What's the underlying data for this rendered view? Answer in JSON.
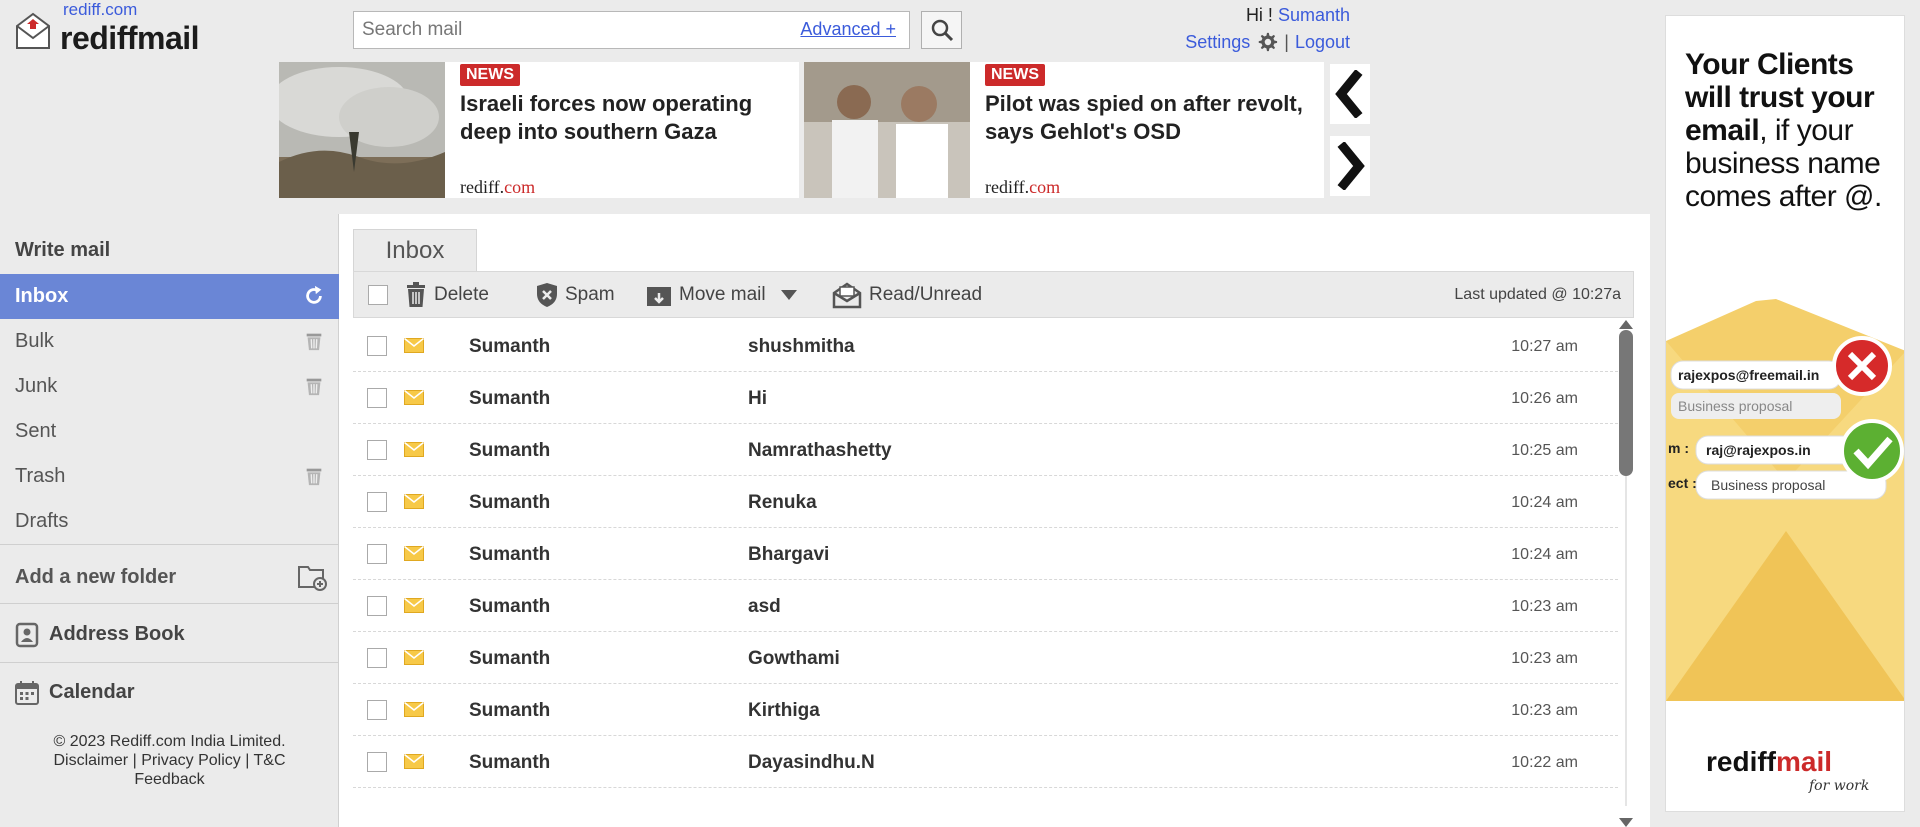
{
  "header": {
    "brand_link": "rediff.com",
    "brand_name": "rediffmail",
    "search_placeholder": "Search mail",
    "advanced_link": "Advanced +",
    "greeting_prefix": "Hi !",
    "user_name": "Sumanth",
    "settings_label": "Settings",
    "logout_label": "Logout"
  },
  "news": [
    {
      "badge": "NEWS",
      "headline": "Israeli forces now operating deep into southern Gaza",
      "source_a": "rediff.",
      "source_b": "com"
    },
    {
      "badge": "NEWS",
      "headline": "Pilot was spied on after revolt, says Gehlot's OSD",
      "source_a": "rediff.",
      "source_b": "com"
    }
  ],
  "sidebar": {
    "write_mail": "Write mail",
    "folders": [
      {
        "label": "Inbox",
        "active": true
      },
      {
        "label": "Bulk"
      },
      {
        "label": "Junk"
      },
      {
        "label": "Sent"
      },
      {
        "label": "Trash"
      },
      {
        "label": "Drafts"
      }
    ],
    "add_folder": "Add a new folder",
    "address_book": "Address Book",
    "calendar": "Calendar",
    "footer": {
      "copyright": "© 2023 Rediff.com India Limited.",
      "disclaimer": "Disclaimer",
      "privacy": "Privacy Policy",
      "tc": "T&C",
      "feedback": "Feedback",
      "separator": "|"
    }
  },
  "mail": {
    "tab_label": "Inbox",
    "toolbar": {
      "delete": "Delete",
      "spam": "Spam",
      "move": "Move mail",
      "read_unread": "Read/Unread",
      "last_updated": "Last updated  @ 10:27a"
    },
    "rows": [
      {
        "from": "Sumanth",
        "subject": "shushmitha",
        "time": "10:27 am"
      },
      {
        "from": "Sumanth",
        "subject": "Hi",
        "time": "10:26 am"
      },
      {
        "from": "Sumanth",
        "subject": "Namrathashetty",
        "time": "10:25 am"
      },
      {
        "from": "Sumanth",
        "subject": "Renuka",
        "time": "10:24 am"
      },
      {
        "from": "Sumanth",
        "subject": "Bhargavi",
        "time": "10:24 am"
      },
      {
        "from": "Sumanth",
        "subject": "asd",
        "time": "10:23 am"
      },
      {
        "from": "Sumanth",
        "subject": "Gowthami",
        "time": "10:23 am"
      },
      {
        "from": "Sumanth",
        "subject": "Kirthiga",
        "time": "10:23 am"
      },
      {
        "from": "Sumanth",
        "subject": "Dayasindhu.N",
        "time": "10:22 am"
      }
    ]
  },
  "ad": {
    "headline_bold": "Your Clients will trust your email",
    "headline_rest": ", if your business name comes after @.",
    "email_bad": "rajexpos@freemail.in",
    "email_good": "raj@rajexpos.in",
    "subject_1": "Business proposal",
    "subject_2": "Business proposal",
    "label_from": "m :",
    "label_subject": "ect :",
    "logo_a": "rediff",
    "logo_b": "mail",
    "logo_sub": "for work"
  },
  "colors": {
    "accent": "#6a86d6",
    "link": "#3b5bdb",
    "brand_red": "#cc2a2a",
    "envelope": "#f0b429"
  }
}
